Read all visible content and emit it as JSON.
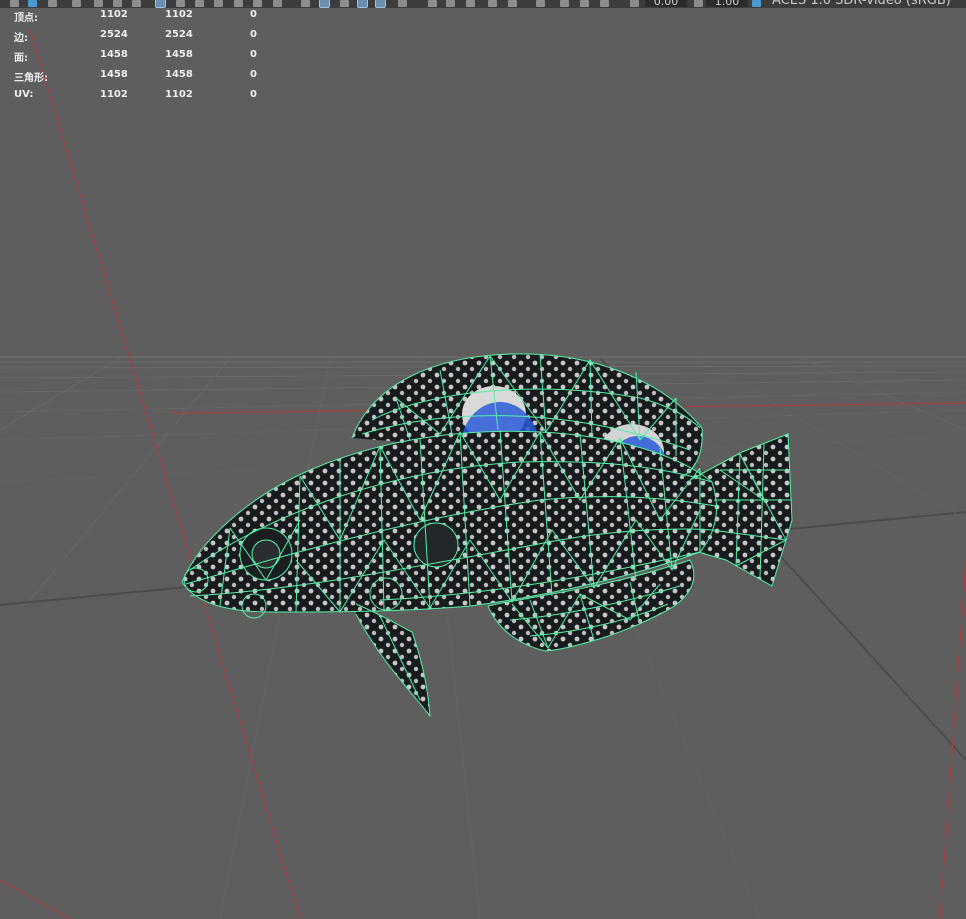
{
  "toolbar": {
    "exposure_value": "0.00",
    "gamma_value": "1.00",
    "color_space_label": "ACES 1.0 SDR-video (sRGB)"
  },
  "hud": {
    "rows": [
      {
        "label": "顶点:",
        "c1": "1102",
        "c2": "1102",
        "c3": "0"
      },
      {
        "label": "边:",
        "c1": "2524",
        "c2": "2524",
        "c3": "0"
      },
      {
        "label": "面:",
        "c1": "1458",
        "c2": "1458",
        "c3": "0"
      },
      {
        "label": "三角形:",
        "c1": "1458",
        "c2": "1458",
        "c3": "0"
      },
      {
        "label": "UV:",
        "c1": "1102",
        "c2": "1102",
        "c3": "0"
      }
    ]
  },
  "colors": {
    "viewport_bg": "#5e5e5e",
    "grid_line": "#6c6c6c",
    "grid_line_dark": "#4e4e4e",
    "axis_red": "#b23a3a",
    "wireframe": "#54f0a8",
    "texture_dark": "#181b1d",
    "texture_blue": "#2a5ad8"
  }
}
